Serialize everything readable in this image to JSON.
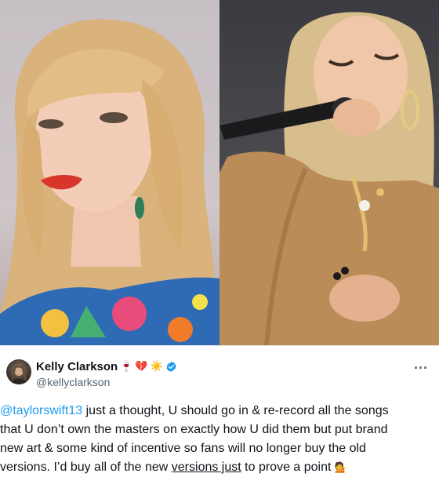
{
  "tweet": {
    "display_name": "Kelly Clarkson",
    "name_emojis": [
      "🍷",
      "💔",
      "☀️"
    ],
    "handle": "@kellyclarkson",
    "more_label": "...",
    "mention": "@taylorswift13",
    "line1_rest": " just a thought, U should go in & re-record all the songs",
    "line2": "that U don’t own the masters on exactly how U did them but put brand",
    "line3": "new art & some kind of incentive so fans will no longer buy the old",
    "line4_a": "versions. I’d buy all of the new ",
    "line4_b": "versions just",
    "line4_c": " to prove a point ",
    "line4_emoji": "💁"
  },
  "colors": {
    "mention": "#1d9bf0",
    "verified": "#1d9bf0",
    "text": "#0f1419",
    "secondary": "#536471"
  },
  "icons": {
    "verified": "verified-badge-icon",
    "more": "more-horizontal-icon"
  }
}
